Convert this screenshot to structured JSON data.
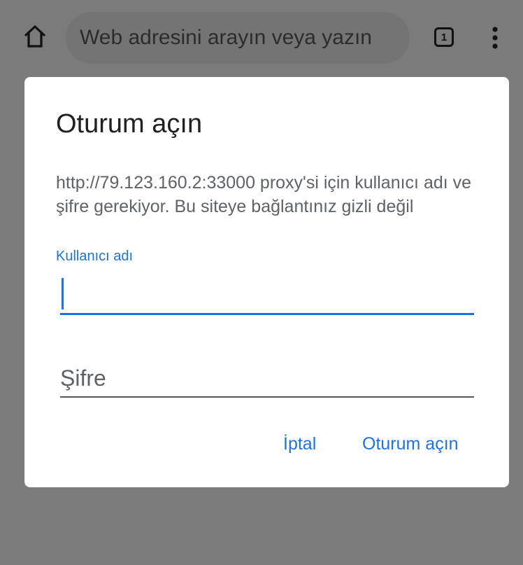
{
  "toolbar": {
    "home_icon": "home-icon",
    "omnibox_placeholder": "Web adresini arayın veya yazın",
    "tab_count": "1",
    "menu_icon": "more-vert-icon"
  },
  "dialog": {
    "title": "Oturum açın",
    "message": "http://79.123.160.2:33000 proxy'si için kullanıcı adı ve şifre gerekiyor. Bu siteye bağlantınız gizli değil",
    "username_label": "Kullanıcı adı",
    "username_value": "",
    "password_placeholder": "Şifre",
    "cancel_label": "İptal",
    "signin_label": "Oturum açın"
  },
  "colors": {
    "accent": "#1a73e8",
    "scrim": "#7b7b7b",
    "dialog_bg": "#ffffff"
  }
}
